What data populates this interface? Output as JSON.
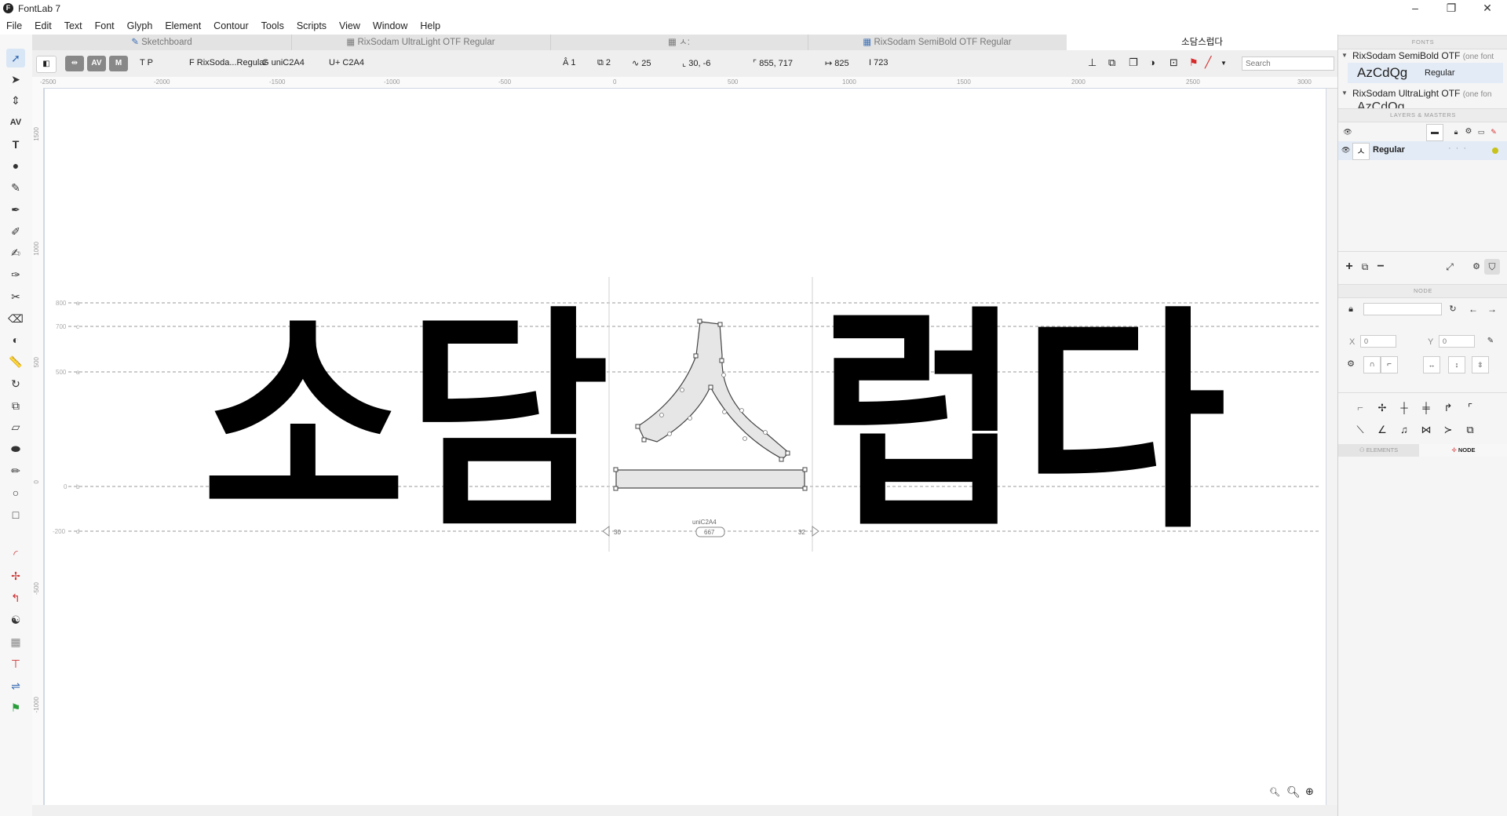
{
  "window": {
    "app_icon": "F",
    "title": "FontLab 7",
    "controls": [
      "–",
      "❐",
      "✕"
    ]
  },
  "menu": [
    "File",
    "Edit",
    "Text",
    "Font",
    "Glyph",
    "Element",
    "Contour",
    "Tools",
    "Scripts",
    "View",
    "Window",
    "Help"
  ],
  "tabs": [
    {
      "label": "Sketchboard",
      "icon": "pencil-icon"
    },
    {
      "label": "RixSodam UltraLight OTF Regular",
      "icon": "grid-icon"
    },
    {
      "label": "ㅅ:",
      "icon": "glyph-icon"
    },
    {
      "label": "RixSodam SemiBold OTF Regular",
      "icon": "grid-icon"
    },
    {
      "label": "소담스럽다",
      "icon": ""
    }
  ],
  "propbar": {
    "font_label": "F RixSoda...Regular",
    "glyph_label": "G uniC2A4",
    "unicode_label": "U+ C2A4",
    "tp_label": "T P",
    "layers_count": "1",
    "contours_count": "2",
    "nodes_count": "25",
    "position": "30, -6",
    "size": "855, 717",
    "advance_width": "825",
    "height_value": "723",
    "search_placeholder": "Search"
  },
  "ruler_top": [
    "-2500",
    "-2000",
    "-1500",
    "-1000",
    "-500",
    "0",
    "500",
    "1000",
    "1500",
    "2000",
    "2500",
    "3000"
  ],
  "ruler_left": [
    "1500",
    "1000",
    "500",
    "0",
    "-500",
    "-1000"
  ],
  "canvas": {
    "text_left": "소담",
    "text_right": "럽다",
    "metrics": [
      {
        "label": "800",
        "key": "a"
      },
      {
        "label": "700",
        "key": "c"
      },
      {
        "label": "500",
        "key": "a"
      },
      {
        "label": "0",
        "key": "b"
      },
      {
        "label": "-200",
        "key": "d"
      }
    ],
    "glyph_name": "uniC2A4",
    "glyph_width": "667",
    "lsb": "30",
    "rsb": "32"
  },
  "fonts_panel": {
    "header": "FONTS",
    "fonts": [
      {
        "name": "RixSodam SemiBold OTF",
        "note": "(one font",
        "sample": "AzCdQg",
        "style": "Regular"
      },
      {
        "name": "RixSodam UltraLight OTF",
        "note": "(one fon",
        "sample": "AzCdQg",
        "style": ""
      }
    ]
  },
  "layers_panel": {
    "header": "LAYERS & MASTERS",
    "layer_name": "Regular",
    "layer_glyph": "ㅅ"
  },
  "node_panel": {
    "header": "NODE",
    "x_label": "X",
    "y_label": "Y",
    "x_placeholder": "0",
    "y_placeholder": "0"
  },
  "bottom_tabs": [
    "ELEMENTS",
    "NODE"
  ],
  "colors": {
    "accent": "#3b6fb5",
    "selection": "#d9e6f5",
    "glyph_fill": "#e6e6e6",
    "layer_dot": "#c8c21a",
    "red": "#d62b2b"
  }
}
